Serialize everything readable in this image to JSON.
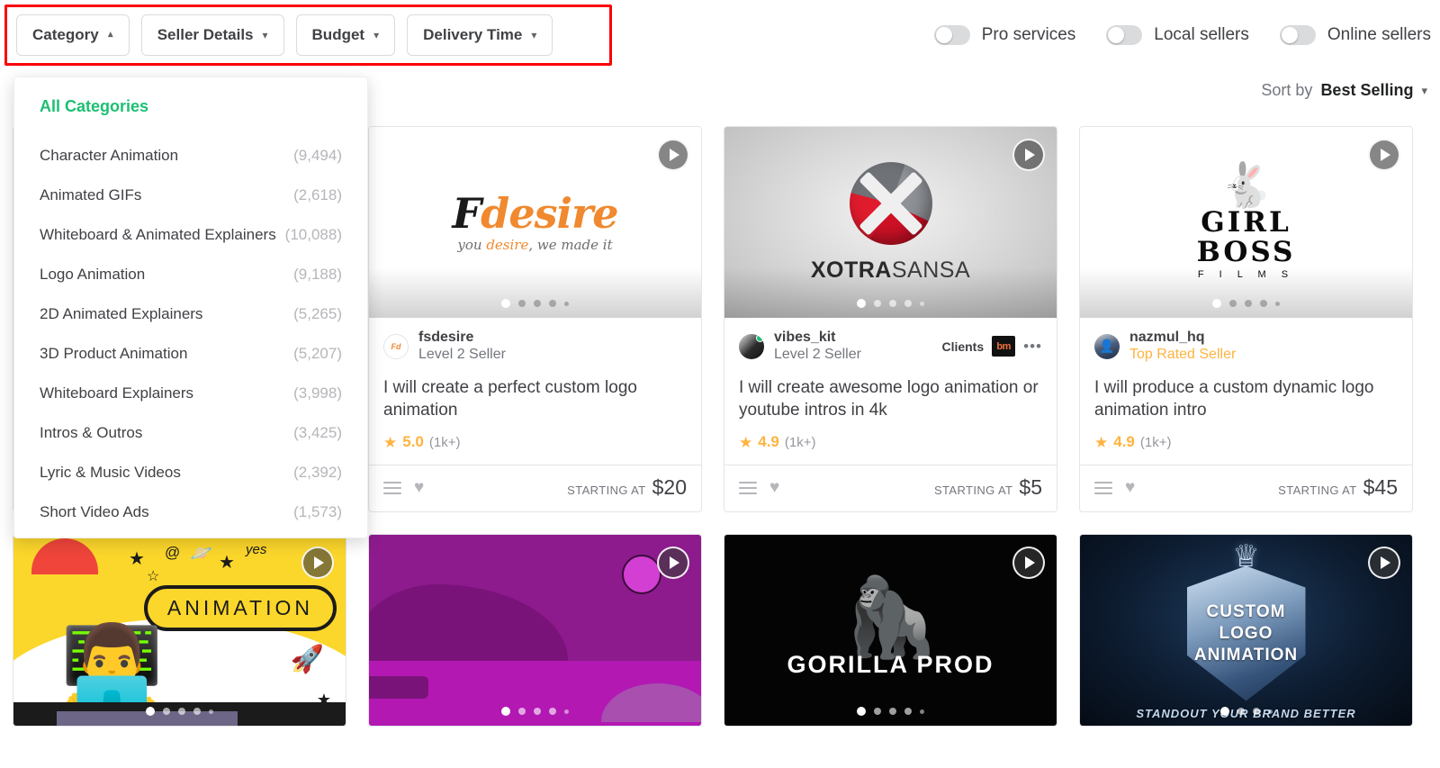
{
  "filters": {
    "buttons": [
      {
        "label": "Category",
        "chevron": "chevron-up",
        "active": true
      },
      {
        "label": "Seller Details",
        "chevron": "chevron-down",
        "active": false
      },
      {
        "label": "Budget",
        "chevron": "chevron-down",
        "active": false
      },
      {
        "label": "Delivery Time",
        "chevron": "chevron-down",
        "active": false
      }
    ],
    "highlight_color": "#fb0007"
  },
  "toggles": [
    {
      "label": "Pro services",
      "on": false
    },
    {
      "label": "Local sellers",
      "on": false
    },
    {
      "label": "Online sellers",
      "on": false
    }
  ],
  "sort": {
    "prefix": "Sort by",
    "value": "Best Selling",
    "chevron": "chevron-down"
  },
  "category_dropdown": {
    "all_label": "All Categories",
    "accent_color": "#1dbf73",
    "items": [
      {
        "label": "Character Animation",
        "count": "(9,494)"
      },
      {
        "label": "Animated GIFs",
        "count": "(2,618)"
      },
      {
        "label": "Whiteboard & Animated Explainers",
        "count": "(10,088)"
      },
      {
        "label": "Logo Animation",
        "count": "(9,188)"
      },
      {
        "label": "2D Animated Explainers",
        "count": "(5,265)"
      },
      {
        "label": "3D Product Animation",
        "count": "(5,207)"
      },
      {
        "label": "Whiteboard Explainers",
        "count": "(3,998)"
      },
      {
        "label": "Intros & Outros",
        "count": "(3,425)"
      },
      {
        "label": "Lyric & Music Videos",
        "count": "(2,392)"
      },
      {
        "label": "Short Video Ads",
        "count": "(1,573)"
      }
    ]
  },
  "cards": [
    {
      "id": "card-1-hidden",
      "scene": "hidden",
      "seller": "",
      "level": "",
      "title": "",
      "rating": "",
      "reviews": "",
      "starting_at": "",
      "price": ""
    },
    {
      "scene": "fdesire",
      "thumb_text": {
        "logo_main": "desire",
        "logo_initial": "F",
        "tagline_a": "you ",
        "tagline_b": "desire",
        "tagline_c": ", we made it"
      },
      "seller": "fsdesire",
      "level": "Level 2 Seller",
      "level_type": "normal",
      "title": "I will create a perfect custom logo animation",
      "rating": "5.0",
      "reviews": "(1k+)",
      "starting_at": "STARTING AT",
      "price": "$20",
      "avatar_class": "av-fsdesire",
      "avatar_text": "Fd",
      "online": false,
      "clients": null
    },
    {
      "scene": "xotra",
      "thumb_text": {
        "brand_bold": "XOTRA",
        "brand_light": "SANSA"
      },
      "seller": "vibes_kit",
      "level": "Level 2 Seller",
      "level_type": "normal",
      "title": "I will create awesome logo animation or youtube intros in 4k",
      "rating": "4.9",
      "reviews": "(1k+)",
      "starting_at": "STARTING AT",
      "price": "$5",
      "avatar_class": "av-vibes",
      "avatar_text": "",
      "online": true,
      "clients": {
        "label": "Clients",
        "brand": "bm",
        "more": "•••"
      }
    },
    {
      "scene": "girlboss",
      "thumb_text": {
        "line1": "GIRL",
        "line2": "BOSS",
        "line3": "F I L M S"
      },
      "seller": "nazmul_hq",
      "level": "Top Rated Seller",
      "level_type": "top",
      "title": "I will produce a custom dynamic logo animation intro",
      "rating": "4.9",
      "reviews": "(1k+)",
      "starting_at": "STARTING AT",
      "price": "$45",
      "avatar_class": "av-nazmul",
      "avatar_text": "",
      "online": false,
      "clients": null
    },
    {
      "scene": "animation-yellow",
      "thumb_text": {
        "bubble": "ANIMATION",
        "deco_at": "@",
        "deco_yes": "yes"
      }
    },
    {
      "scene": "magenta",
      "thumb_text": {}
    },
    {
      "scene": "gorilla",
      "thumb_text": {
        "brand": "GORILLA PROD"
      }
    },
    {
      "scene": "crest",
      "thumb_text": {
        "line1": "CUSTOM",
        "line2": "LOGO",
        "line3": "ANIMATION",
        "sub": "STANDOUT YOUR BRAND BETTER"
      }
    }
  ],
  "icons": {
    "play": "play-icon",
    "heart": "♥",
    "star": "★",
    "chevron_down": "⌄",
    "chevron_up": "⌃"
  }
}
